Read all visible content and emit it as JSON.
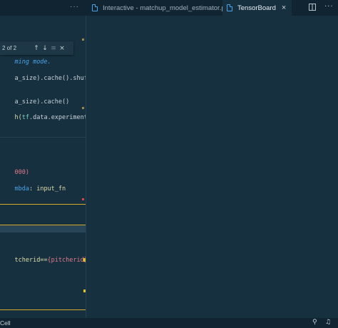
{
  "tabs": [
    {
      "label": "Interactive - matchup_model_estimator.py",
      "active": false
    },
    {
      "label": "TensorBoard",
      "active": true
    }
  ],
  "more_label": "···",
  "find_widget": {
    "count": "2 of 2"
  },
  "code_lines": [
    {
      "text": "ming mode.",
      "kind": "comment"
    },
    {
      "text": "a_size).cache().shuffle",
      "kind": "plain"
    },
    {
      "text": "a_size).cache()",
      "kind": "plain"
    },
    {
      "pre": "h(",
      "ident": "tf",
      "post": ".data.experimental.",
      "kind": "mixed"
    },
    {
      "text": "000)",
      "kind": "num"
    },
    {
      "pre": "mbda",
      "post": ": input_fn",
      "kind": "lambda"
    },
    {
      "pre": "tcherid==",
      "brace": "{pitcherid}",
      "post": ") &",
      "kind": "fstring"
    }
  ],
  "status": {
    "left_text": "Cell"
  },
  "colors": {
    "accent": "#4aa2e8",
    "highlight_border": "#d9a928",
    "background": "#17303f"
  },
  "icons": [
    "file-icon",
    "close-icon",
    "split-editor-icon",
    "more-actions-icon",
    "arrow-up-icon",
    "arrow-down-icon",
    "find-selection-icon",
    "remote-icon",
    "notifications-icon"
  ]
}
